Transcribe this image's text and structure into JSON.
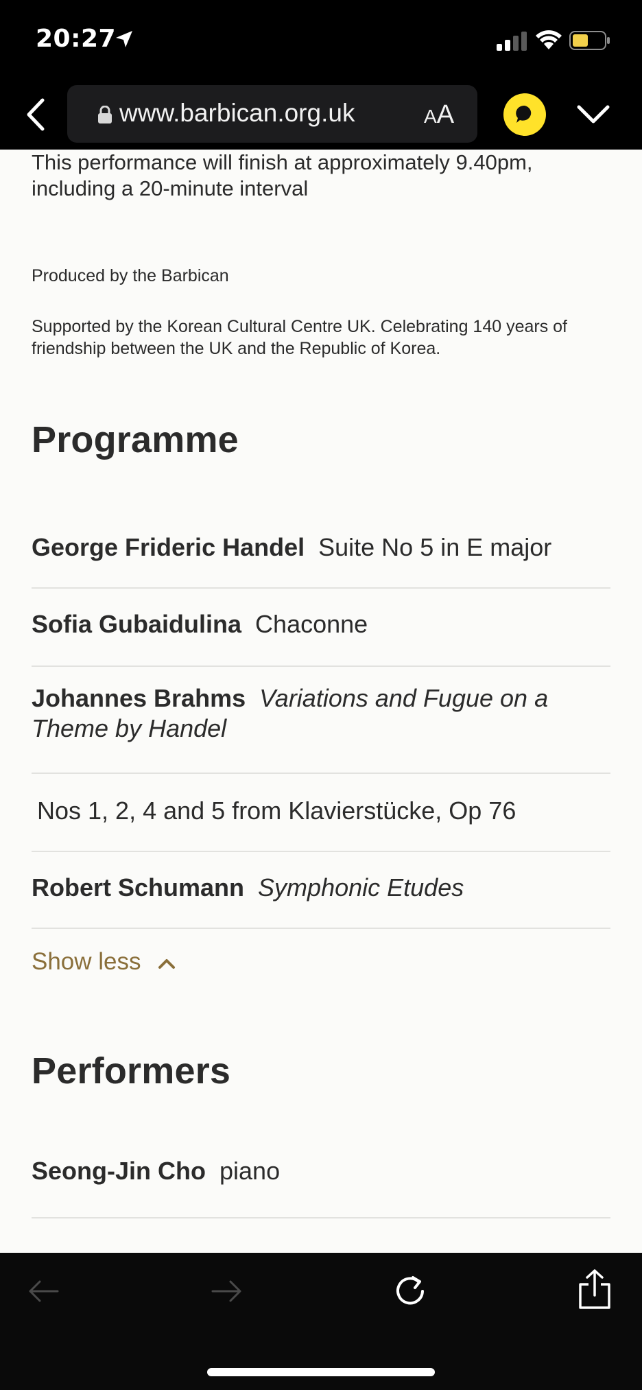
{
  "status_bar": {
    "time": "20:27",
    "icons": [
      "location-arrow-icon",
      "cellular-signal-icon",
      "wifi-icon",
      "battery-icon"
    ],
    "battery_color": "#f2d04b"
  },
  "browser": {
    "url": "www.barbican.org.uk",
    "aa_small": "A",
    "aa_big": "A",
    "accent": "#ffe22a"
  },
  "event": {
    "finish_text": "This performance will finish at approximately 9.40pm, including a 20-minute interval",
    "produced_by": "Produced by the Barbican",
    "supported_by": "Supported by the Korean Cultural Centre UK. Celebrating 140 years of friendship between the UK and the Republic of Korea."
  },
  "programme": {
    "heading": "Programme",
    "items": [
      {
        "composer": "George Frideric Handel",
        "work": "Suite No 5 in E major",
        "italic": false
      },
      {
        "composer": "Sofia Gubaidulina",
        "work": "Chaconne",
        "italic": false
      },
      {
        "composer": "Johannes Brahms",
        "work": "Variations and Fugue on a Theme by Handel",
        "italic": true
      },
      {
        "composer": "",
        "work": "Nos 1, 2, 4 and 5 from Klavierstücke, Op 76",
        "italic": false
      },
      {
        "composer": "Robert Schumann",
        "work": "Symphonic Etudes",
        "italic": true
      }
    ],
    "show_less_label": "Show less",
    "link_color": "#8a6f3a"
  },
  "performers": {
    "heading": "Performers",
    "items": [
      {
        "name": "Seong-Jin Cho",
        "role": "piano"
      }
    ]
  }
}
